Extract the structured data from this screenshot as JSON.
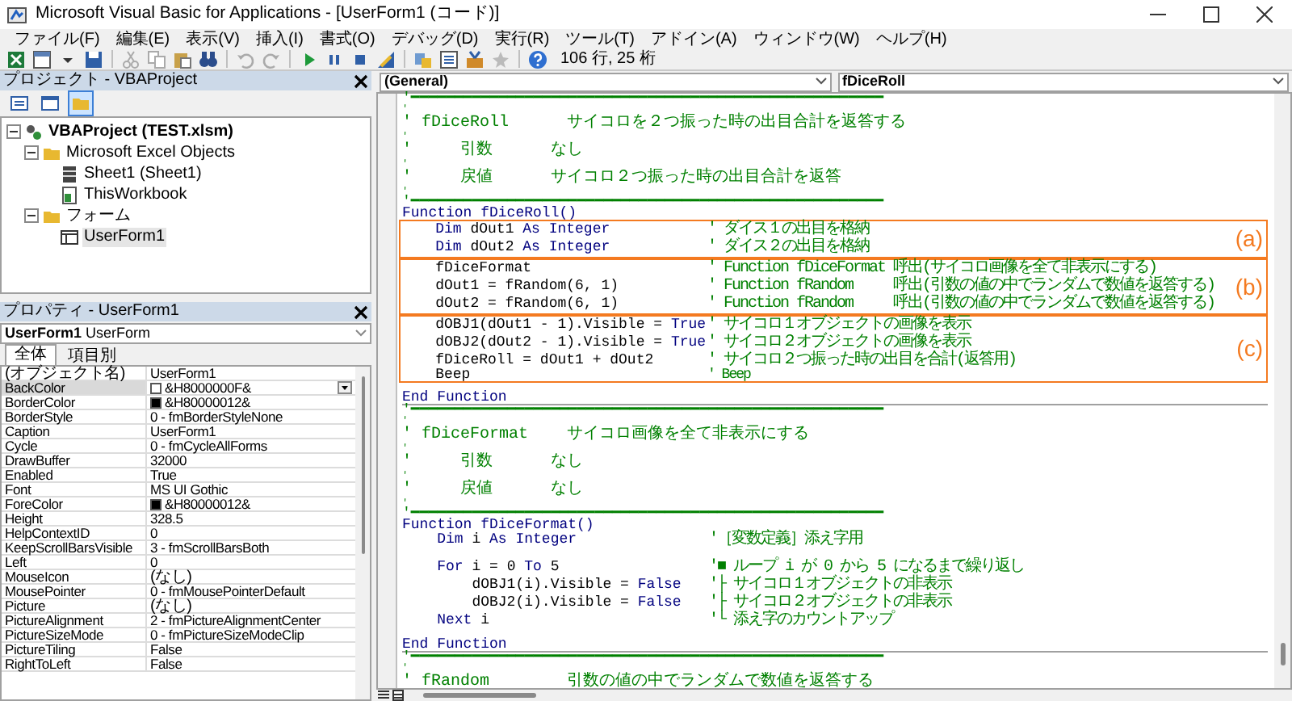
{
  "window": {
    "title": "Microsoft Visual Basic for Applications - [UserForm1 (コード)]"
  },
  "menu": [
    "ファイル(F)",
    "編集(E)",
    "表示(V)",
    "挿入(I)",
    "書式(O)",
    "デバッグ(D)",
    "実行(R)",
    "ツール(T)",
    "アドイン(A)",
    "ウィンドウ(W)",
    "ヘルプ(H)"
  ],
  "toolbar": {
    "position": "106 行, 25 桁"
  },
  "project_pane": {
    "title": "プロジェクト - VBAProject",
    "view_buttons": [
      {
        "selected": false
      },
      {
        "selected": false
      },
      {
        "selected": true
      }
    ],
    "tree": [
      {
        "label": "VBAProject (TEST.xlsm)",
        "kind": "project",
        "expanded": true,
        "selected": false,
        "children": [
          {
            "label": "Microsoft Excel Objects",
            "kind": "folder",
            "expanded": true,
            "selected": false,
            "children": [
              {
                "label": "Sheet1 (Sheet1)",
                "kind": "sheet",
                "selected": false
              },
              {
                "label": "ThisWorkbook",
                "kind": "workbook",
                "selected": false
              }
            ]
          },
          {
            "label": "フォーム",
            "kind": "folder",
            "expanded": true,
            "selected": false,
            "children": [
              {
                "label": "UserForm1",
                "kind": "form",
                "selected": true
              }
            ]
          }
        ]
      }
    ]
  },
  "properties_pane": {
    "title": "プロパティ - UserForm1",
    "object": "**UserForm1** UserForm",
    "tabs": [
      {
        "label": "全体",
        "selected": true
      },
      {
        "label": "項目別",
        "selected": false
      }
    ],
    "rows": [
      {
        "name": "(オブジェクト名)",
        "value": "UserForm1",
        "selected": false
      },
      {
        "name": "BackColor",
        "value": "&H8000000F&",
        "color": "#ffffff",
        "selected": true
      },
      {
        "name": "BorderColor",
        "value": "&H80000012&",
        "color": "#000000",
        "selected": false
      },
      {
        "name": "BorderStyle",
        "value": "0 - fmBorderStyleNone",
        "selected": false
      },
      {
        "name": "Caption",
        "value": "UserForm1",
        "selected": false
      },
      {
        "name": "Cycle",
        "value": "0 - fmCycleAllForms",
        "selected": false
      },
      {
        "name": "DrawBuffer",
        "value": "32000",
        "selected": false
      },
      {
        "name": "Enabled",
        "value": "True",
        "selected": false
      },
      {
        "name": "Font",
        "value": "MS UI Gothic",
        "selected": false
      },
      {
        "name": "ForeColor",
        "value": "&H80000012&",
        "color": "#000000",
        "selected": false
      },
      {
        "name": "Height",
        "value": "328.5",
        "selected": false
      },
      {
        "name": "HelpContextID",
        "value": "0",
        "selected": false
      },
      {
        "name": "KeepScrollBarsVisible",
        "value": "3 - fmScrollBarsBoth",
        "selected": false
      },
      {
        "name": "Left",
        "value": "0",
        "selected": false
      },
      {
        "name": "MouseIcon",
        "value": "(なし)",
        "selected": false
      },
      {
        "name": "MousePointer",
        "value": "0 - fmMousePointerDefault",
        "selected": false
      },
      {
        "name": "Picture",
        "value": "(なし)",
        "selected": false
      },
      {
        "name": "PictureAlignment",
        "value": "2 - fmPictureAlignmentCenter",
        "selected": false
      },
      {
        "name": "PictureSizeMode",
        "value": "0 - fmPictureSizeModeClip",
        "selected": false
      },
      {
        "name": "PictureTiling",
        "value": "False",
        "selected": false
      },
      {
        "name": "RightToLeft",
        "value": "False",
        "selected": false
      }
    ]
  },
  "code_window": {
    "object": "(General)",
    "procedure": "fDiceRoll",
    "sections": [
      {
        "items": [
          {
            "kind": "line",
            "code": [
              {
                "kind": "comment",
                "text": "'━━━━━━━━━━━━━━━━━━━━━━━━━━━━━━━━━━━━━━━━━━━━━━━━━━━━━━"
              }
            ]
          },
          {
            "kind": "line",
            "code": [
              {
                "kind": "comment",
                "text": "'"
              }
            ]
          },
          {
            "kind": "line",
            "code": [
              {
                "kind": "comment",
                "text": "' fDiceRoll      サイコロを２つ振った時の出目合計を返答する"
              }
            ]
          },
          {
            "kind": "line",
            "code": [
              {
                "kind": "comment",
                "text": "'"
              }
            ]
          },
          {
            "kind": "line",
            "code": [
              {
                "kind": "comment",
                "text": "'     引数      なし"
              }
            ]
          },
          {
            "kind": "line",
            "code": [
              {
                "kind": "comment",
                "text": "'"
              }
            ]
          },
          {
            "kind": "line",
            "code": [
              {
                "kind": "comment",
                "text": "'     戻値      サイコロ２つ振った時の出目合計を返答"
              }
            ]
          },
          {
            "kind": "line",
            "code": [
              {
                "kind": "comment",
                "text": "'"
              }
            ]
          },
          {
            "kind": "line",
            "code": [
              {
                "kind": "comment",
                "text": "'━━━━━━━━━━━━━━━━━━━━━━━━━━━━━━━━━━━━━━━━━━━━━━━━━━━━━━"
              }
            ]
          },
          {
            "kind": "line",
            "code": [
              {
                "kind": "keyword",
                "text": "Function fDiceRoll()"
              }
            ]
          },
          {
            "kind": "group",
            "label": "(a)",
            "lines": [
              {
                "code": [
                  {
                    "kind": "keyword",
                    "text": "    Dim"
                  },
                  {
                    "kind": "plain",
                    "text": " dOut1 "
                  },
                  {
                    "kind": "keyword",
                    "text": "As Integer"
                  }
                ],
                "comment": "' ダイス１の出目を格納"
              },
              {
                "code": [
                  {
                    "kind": "keyword",
                    "text": "    Dim"
                  },
                  {
                    "kind": "plain",
                    "text": " dOut2 "
                  },
                  {
                    "kind": "keyword",
                    "text": "As Integer"
                  }
                ],
                "comment": "' ダイス２の出目を格納"
              }
            ]
          },
          {
            "kind": "group",
            "label": "(b)",
            "lines": [
              {
                "code": [
                  {
                    "kind": "plain",
                    "text": "    fDiceFormat"
                  }
                ],
                "comment": "' Function fDiceFormat 呼出(サイコロ画像を全て非表示にする)"
              },
              {
                "code": [
                  {
                    "kind": "plain",
                    "text": "    dOut1 = fRandom(6, 1)"
                  }
                ],
                "comment": "' Function fRandom     呼出(引数の値の中でランダムで数値を返答する)"
              },
              {
                "code": [
                  {
                    "kind": "plain",
                    "text": "    dOut2 = fRandom(6, 1)"
                  }
                ],
                "comment": "' Function fRandom     呼出(引数の値の中でランダムで数値を返答する)"
              }
            ]
          },
          {
            "kind": "group",
            "label": "(c)",
            "lines": [
              {
                "code": [
                  {
                    "kind": "plain",
                    "text": "    dOBJ1(dOut1 - 1).Visible = "
                  },
                  {
                    "kind": "keyword",
                    "text": "True"
                  }
                ],
                "comment": "' サイコロ１オブジェクトの画像を表示"
              },
              {
                "code": [
                  {
                    "kind": "plain",
                    "text": "    dOBJ2(dOut2 - 1).Visible = "
                  },
                  {
                    "kind": "keyword",
                    "text": "True"
                  }
                ],
                "comment": "' サイコロ２オブジェクトの画像を表示"
              },
              {
                "code": [
                  {
                    "kind": "plain",
                    "text": "    fDiceRoll = dOut1 + dOut2"
                  }
                ],
                "comment": "' サイコロ２つ振った時の出目を合計(返答用)"
              },
              {
                "code": [
                  {
                    "kind": "plain",
                    "text": "    Beep"
                  }
                ],
                "comment": "' Beep"
              }
            ]
          },
          {
            "kind": "blank"
          },
          {
            "kind": "line",
            "code": [
              {
                "kind": "keyword",
                "text": "End Function"
              }
            ]
          }
        ]
      },
      {
        "items": [
          {
            "kind": "line",
            "code": [
              {
                "kind": "comment",
                "text": "'━━━━━━━━━━━━━━━━━━━━━━━━━━━━━━━━━━━━━━━━━━━━━━━━━━━━━━"
              }
            ]
          },
          {
            "kind": "line",
            "code": [
              {
                "kind": "comment",
                "text": "'"
              }
            ]
          },
          {
            "kind": "line",
            "code": [
              {
                "kind": "comment",
                "text": "' fDiceFormat    サイコロ画像を全て非表示にする"
              }
            ]
          },
          {
            "kind": "line",
            "code": [
              {
                "kind": "comment",
                "text": "'"
              }
            ]
          },
          {
            "kind": "line",
            "code": [
              {
                "kind": "comment",
                "text": "'     引数      なし"
              }
            ]
          },
          {
            "kind": "line",
            "code": [
              {
                "kind": "comment",
                "text": "'"
              }
            ]
          },
          {
            "kind": "line",
            "code": [
              {
                "kind": "comment",
                "text": "'     戻値      なし"
              }
            ]
          },
          {
            "kind": "line",
            "code": [
              {
                "kind": "comment",
                "text": "'"
              }
            ]
          },
          {
            "kind": "line",
            "code": [
              {
                "kind": "comment",
                "text": "'━━━━━━━━━━━━━━━━━━━━━━━━━━━━━━━━━━━━━━━━━━━━━━━━━━━━━━"
              }
            ]
          },
          {
            "kind": "line",
            "code": [
              {
                "kind": "keyword",
                "text": "Function fDiceFormat()"
              }
            ]
          },
          {
            "kind": "line",
            "code": [
              {
                "kind": "keyword",
                "text": "    Dim"
              },
              {
                "kind": "plain",
                "text": " i "
              },
              {
                "kind": "keyword",
                "text": "As Integer"
              }
            ],
            "comment": "'［変数定義］添え字用"
          },
          {
            "kind": "blank"
          },
          {
            "kind": "line",
            "code": [
              {
                "kind": "keyword",
                "text": "    For"
              },
              {
                "kind": "plain",
                "text": " i = 0 "
              },
              {
                "kind": "keyword",
                "text": "To"
              },
              {
                "kind": "plain",
                "text": " 5"
              }
            ],
            "comment": "'■ ループ i が 0 から 5 になるまで繰り返し"
          },
          {
            "kind": "line",
            "code": [
              {
                "kind": "plain",
                "text": "        dOBJ1(i).Visible = "
              },
              {
                "kind": "keyword",
                "text": "False"
              }
            ],
            "comment": "'├ サイコロ１オブジェクトの非表示"
          },
          {
            "kind": "line",
            "code": [
              {
                "kind": "plain",
                "text": "        dOBJ2(i).Visible = "
              },
              {
                "kind": "keyword",
                "text": "False"
              }
            ],
            "comment": "'├ サイコロ２オブジェクトの非表示"
          },
          {
            "kind": "line",
            "code": [
              {
                "kind": "keyword",
                "text": "    Next"
              },
              {
                "kind": "plain",
                "text": " i"
              }
            ],
            "comment": "'└ 添え字のカウントアップ"
          },
          {
            "kind": "blank"
          },
          {
            "kind": "line",
            "code": [
              {
                "kind": "keyword",
                "text": "End Function"
              }
            ]
          }
        ]
      },
      {
        "items": [
          {
            "kind": "line",
            "code": [
              {
                "kind": "comment",
                "text": "'━━━━━━━━━━━━━━━━━━━━━━━━━━━━━━━━━━━━━━━━━━━━━━━━━━━━━━"
              }
            ]
          },
          {
            "kind": "line",
            "code": [
              {
                "kind": "comment",
                "text": "'"
              }
            ]
          },
          {
            "kind": "line",
            "code": [
              {
                "kind": "comment",
                "text": "' fRandom        引数の値の中でランダムで数値を返答する"
              }
            ]
          }
        ]
      }
    ]
  }
}
